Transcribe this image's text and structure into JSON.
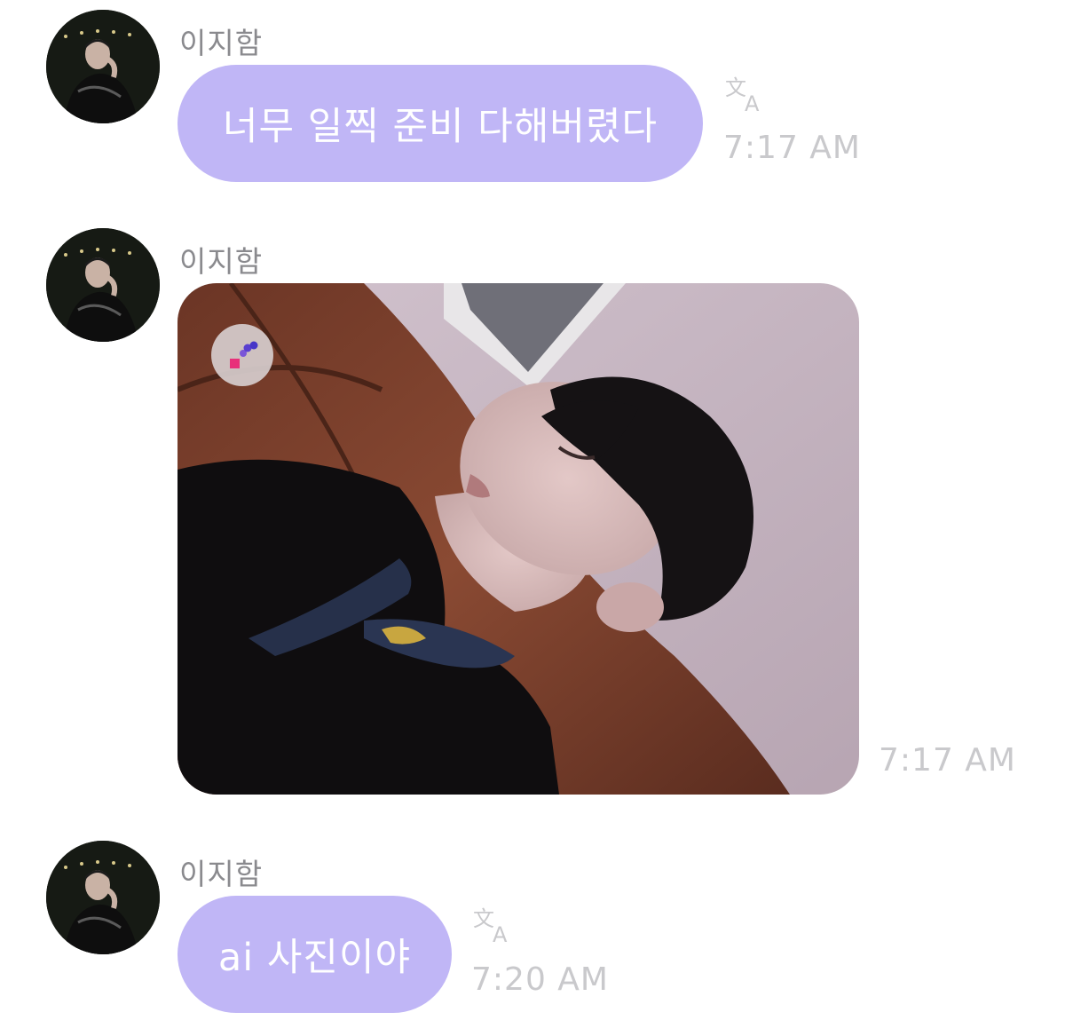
{
  "messages": [
    {
      "sender": "이지함",
      "text": "너무 일찍 준비 다해버렸다",
      "time": "7:17 AM",
      "translate_icon": "translate-icon"
    },
    {
      "sender": "이지함",
      "type": "photo",
      "photo_badge_icon": "app-logo-badge-icon",
      "time": "7:17 AM"
    },
    {
      "sender": "이지함",
      "text": "ai 사진이야",
      "time": "7:20 AM",
      "translate_icon": "translate-icon"
    }
  ],
  "colors": {
    "bubble": "#c0b6f6",
    "bubble_text": "#ffffff",
    "sender_text": "#8a8a8e",
    "time_text": "#c9c9cc"
  }
}
